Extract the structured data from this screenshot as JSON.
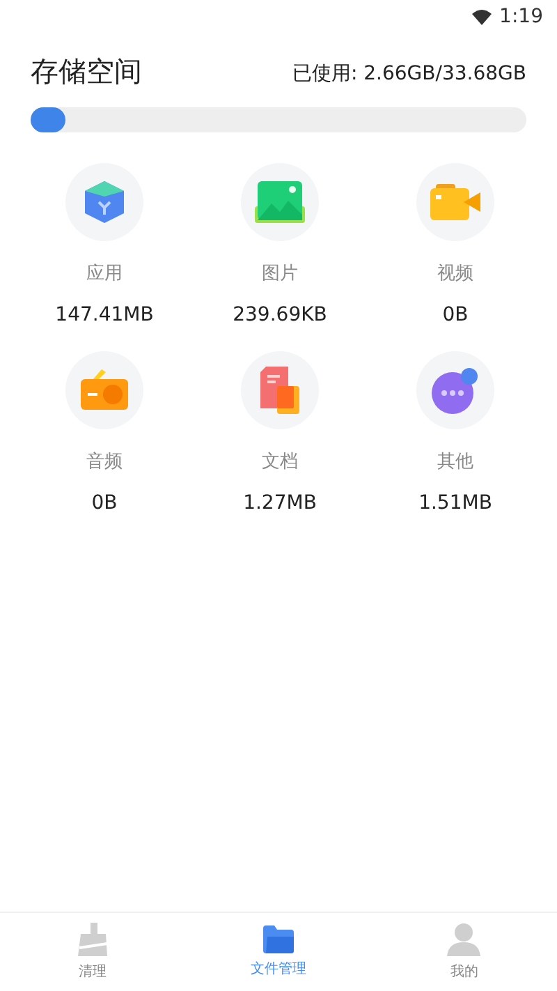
{
  "status_bar": {
    "time": "1:19"
  },
  "storage": {
    "title": "存储空间",
    "used": "已使用: 2.66GB/33.68GB",
    "level": 0.07
  },
  "categories": [
    {
      "kind": "apps",
      "label": "应用",
      "size": "147.41MB"
    },
    {
      "kind": "images",
      "label": "图片",
      "size": "239.69KB"
    },
    {
      "kind": "video",
      "label": "视频",
      "size": "0B"
    },
    {
      "kind": "audio",
      "label": "音频",
      "size": "0B"
    },
    {
      "kind": "docs",
      "label": "文档",
      "size": "1.27MB"
    },
    {
      "kind": "other",
      "label": "其他",
      "size": "1.51MB"
    }
  ],
  "bottom_nav": [
    {
      "kind": "clean",
      "label": "清理",
      "selected": false
    },
    {
      "kind": "files",
      "label": "文件管理",
      "selected": true
    },
    {
      "kind": "profile",
      "label": "我的",
      "selected": false
    }
  ]
}
